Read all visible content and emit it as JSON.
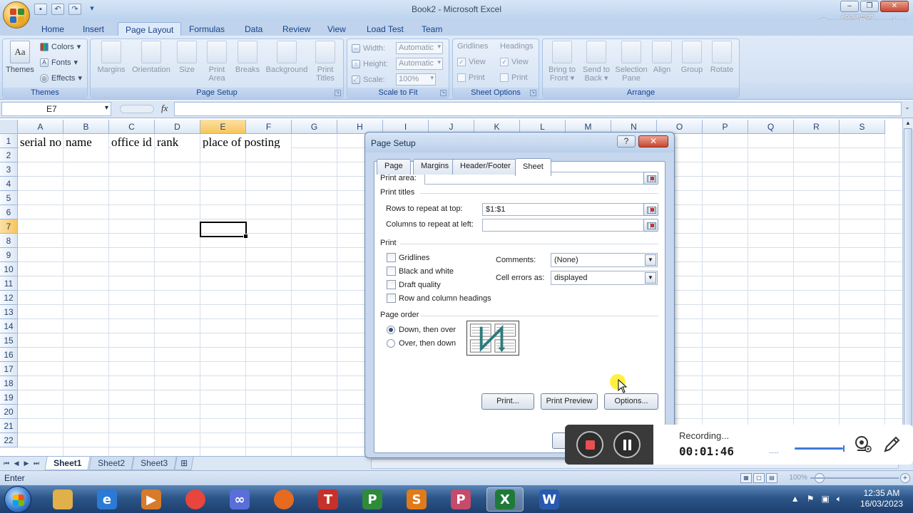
{
  "window": {
    "title": "Book2 - Microsoft Excel"
  },
  "watermark": {
    "brand": "Apowersoft",
    "text": "Screen Recorder"
  },
  "tabs": [
    "Home",
    "Insert",
    "Page Layout",
    "Formulas",
    "Data",
    "Review",
    "View",
    "Load Test",
    "Team"
  ],
  "active_tab": "Page Layout",
  "ribbon": {
    "themes": {
      "label": "Themes",
      "big": "Themes",
      "colors": "Colors",
      "fonts": "Fonts",
      "effects": "Effects"
    },
    "page_setup": {
      "label": "Page Setup",
      "margins": "Margins",
      "orientation": "Orientation",
      "size": "Size",
      "print_area_1": "Print",
      "print_area_2": "Area",
      "breaks": "Breaks",
      "background": "Background",
      "print_titles_1": "Print",
      "print_titles_2": "Titles"
    },
    "scale_to_fit": {
      "label": "Scale to Fit",
      "width_label": "Width:",
      "width_value": "Automatic",
      "height_label": "Height:",
      "height_value": "Automatic",
      "scale_label": "Scale:",
      "scale_value": "100%"
    },
    "sheet_options": {
      "label": "Sheet Options",
      "gridlines": "Gridlines",
      "headings": "Headings",
      "view": "View",
      "print": "Print"
    },
    "arrange": {
      "label": "Arrange",
      "bring_to_front_1": "Bring to",
      "bring_to_front_2": "Front",
      "send_to_back_1": "Send to",
      "send_to_back_2": "Back",
      "selection_pane_1": "Selection",
      "selection_pane_2": "Pane",
      "align": "Align",
      "group": "Group",
      "rotate": "Rotate"
    }
  },
  "formula_bar": {
    "name_box": "E7",
    "fx": "fx",
    "value": ""
  },
  "grid": {
    "columns": [
      "A",
      "B",
      "C",
      "D",
      "E",
      "F",
      "G",
      "H",
      "I",
      "J",
      "K",
      "L",
      "M",
      "N",
      "O",
      "P",
      "Q",
      "R",
      "S"
    ],
    "rows": [
      "1",
      "2",
      "3",
      "4",
      "5",
      "6",
      "7",
      "8",
      "9",
      "10",
      "11",
      "12",
      "13",
      "14",
      "15",
      "16",
      "17",
      "18",
      "19",
      "20",
      "21",
      "22"
    ],
    "selected_column": "E",
    "selected_row": "7",
    "cells": {
      "A1": "serial no",
      "B1": "name",
      "C1": "office id",
      "D1": "rank",
      "E1": "place of posting"
    }
  },
  "sheets": [
    "Sheet1",
    "Sheet2",
    "Sheet3"
  ],
  "active_sheet": "Sheet1",
  "status_bar": {
    "mode": "Enter",
    "zoom": "100%"
  },
  "dialog": {
    "title": "Page Setup",
    "help": "?",
    "tabs": [
      "Page",
      "Margins",
      "Header/Footer",
      "Sheet"
    ],
    "active_tab": "Sheet",
    "print_area_label": "Print area:",
    "print_area_value": "",
    "print_titles_label": "Print titles",
    "rows_repeat_label": "Rows to repeat at top:",
    "rows_repeat_value": "$1:$1",
    "cols_repeat_label": "Columns to repeat at left:",
    "cols_repeat_value": "",
    "print_section_label": "Print",
    "gridlines": "Gridlines",
    "black_white": "Black and white",
    "draft_quality": "Draft quality",
    "row_col_headings": "Row and column headings",
    "comments_label": "Comments:",
    "comments_value": "(None)",
    "cell_errors_label": "Cell errors as:",
    "cell_errors_value": "displayed",
    "page_order_label": "Page order",
    "down_then_over": "Down, then over",
    "over_then_down": "Over, then down",
    "print_btn": "Print...",
    "print_preview_btn": "Print Preview",
    "options_btn": "Options..."
  },
  "recorder": {
    "status": "Recording...",
    "time": "00:01:46"
  },
  "taskbar": {
    "apps": [
      {
        "name": "file-explorer",
        "letter": "",
        "color": "#e0b04a"
      },
      {
        "name": "internet-explorer",
        "letter": "e",
        "color": "#2a7ad6"
      },
      {
        "name": "media-player",
        "letter": "▶",
        "color": "#d87a2a"
      },
      {
        "name": "chrome",
        "letter": "",
        "color": "#e8453c"
      },
      {
        "name": "infinity",
        "letter": "∞",
        "color": "#5a6ed8"
      },
      {
        "name": "firefox",
        "letter": "",
        "color": "#e66a1f"
      },
      {
        "name": "t-app",
        "letter": "T",
        "color": "#c8302a"
      },
      {
        "name": "p-app",
        "letter": "P",
        "color": "#2f8a3a"
      },
      {
        "name": "s-app",
        "letter": "S",
        "color": "#e07a1a"
      },
      {
        "name": "powerpoint-app",
        "letter": "P",
        "color": "#c64a6a"
      },
      {
        "name": "excel",
        "letter": "X",
        "color": "#1f7a3a"
      },
      {
        "name": "word",
        "letter": "W",
        "color": "#2a5ab0"
      }
    ],
    "time": "12:35 AM",
    "date": "16/03/2023"
  }
}
